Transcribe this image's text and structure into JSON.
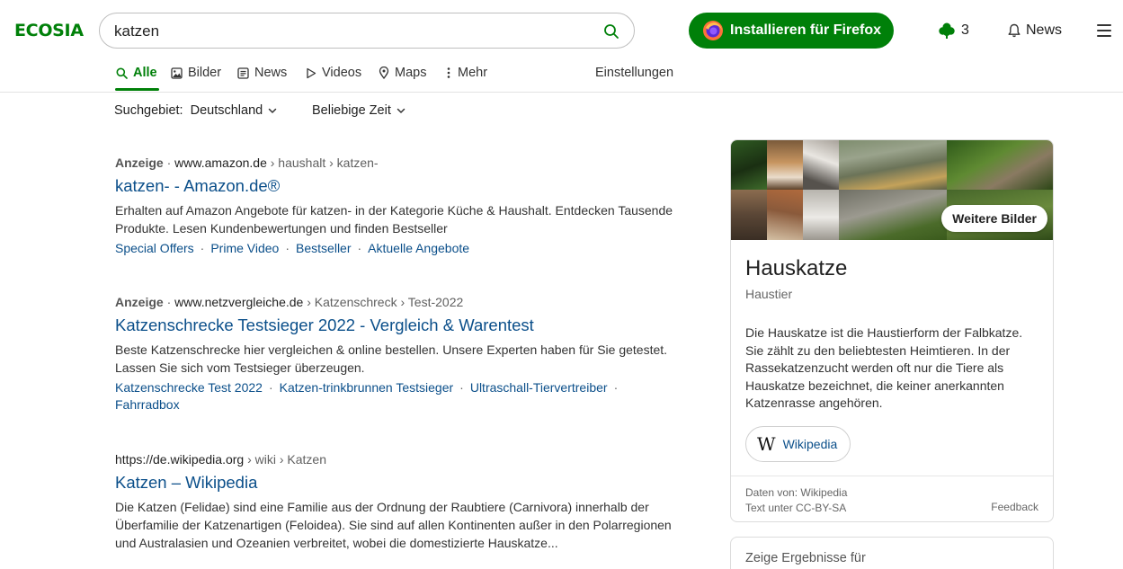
{
  "header": {
    "logo": "ECOSIA",
    "search_value": "katzen",
    "install_label": "Installieren für Firefox",
    "tree_count": "3",
    "news_label": "News"
  },
  "tabs": [
    {
      "label": "Alle",
      "icon": "search-icon"
    },
    {
      "label": "Bilder",
      "icon": "image-icon"
    },
    {
      "label": "News",
      "icon": "news-icon"
    },
    {
      "label": "Videos",
      "icon": "play-icon"
    },
    {
      "label": "Maps",
      "icon": "map-pin-icon"
    },
    {
      "label": "Mehr",
      "icon": "more-vertical-icon"
    },
    {
      "label": "Einstellungen"
    }
  ],
  "filters": {
    "region_label": "Suchgebiet:",
    "region_value": "Deutschland",
    "time_value": "Beliebige Zeit"
  },
  "results": [
    {
      "ad_label": "Anzeige",
      "domain": "www.amazon.de",
      "path": " › haushalt › katzen-",
      "title": "katzen- - Amazon.de®",
      "snippet": "Erhalten auf Amazon Angebote für katzen- in der Kategorie Küche & Haushalt. Entdecken Tausende Produkte. Lesen Kundenbewertungen und finden Bestseller",
      "sitelinks": [
        "Special Offers",
        "Prime Video",
        "Bestseller",
        "Aktuelle Angebote"
      ]
    },
    {
      "ad_label": "Anzeige",
      "domain": "www.netzvergleiche.de",
      "path": " › Katzenschreck › Test-2022",
      "title": "Katzenschrecke Testsieger 2022 - Vergleich & Warentest",
      "snippet": "Beste Katzenschrecke hier vergleichen & online bestellen. Unsere Experten haben für Sie getestet. Lassen Sie sich vom Testsieger überzeugen.",
      "sitelinks": [
        "Katzenschrecke Test 2022",
        "Katzen-trinkbrunnen Testsieger",
        "Ultraschall-Tiervertreiber",
        "Fahrradbox"
      ]
    },
    {
      "domain": "https://de.wikipedia.org",
      "path": " › wiki › Katzen",
      "title": "Katzen – Wikipedia",
      "snippet": "Die Katzen (Felidae) sind eine Familie aus der Ordnung der Raubtiere (Carnivora) innerhalb der Überfamilie der Katzenartigen (Feloidea). Sie sind auf allen Kontinenten außer in den Polarregionen und Australasien und Ozeanien verbreitet, wobei die domestizierte Hauskatze..."
    }
  ],
  "knowledge_panel": {
    "more_images": "Weitere Bilder",
    "title": "Hauskatze",
    "subtitle": "Haustier",
    "description": "Die Hauskatze ist die Haustierform der Falbkatze. Sie zählt zu den beliebtesten Heimtieren. In der Rassekatzenzucht werden oft nur die Tiere als Hauskatze bezeichnet, die keiner anerkannten Katzenrasse angehören.",
    "wiki_label": "Wikipedia",
    "source": "Daten von: Wikipedia",
    "license": "Text unter CC-BY-SA",
    "feedback": "Feedback",
    "next_card": "Zeige Ergebnisse für"
  },
  "colors": {
    "brand_green": "#008009",
    "link_blue": "#0b4f8a"
  }
}
